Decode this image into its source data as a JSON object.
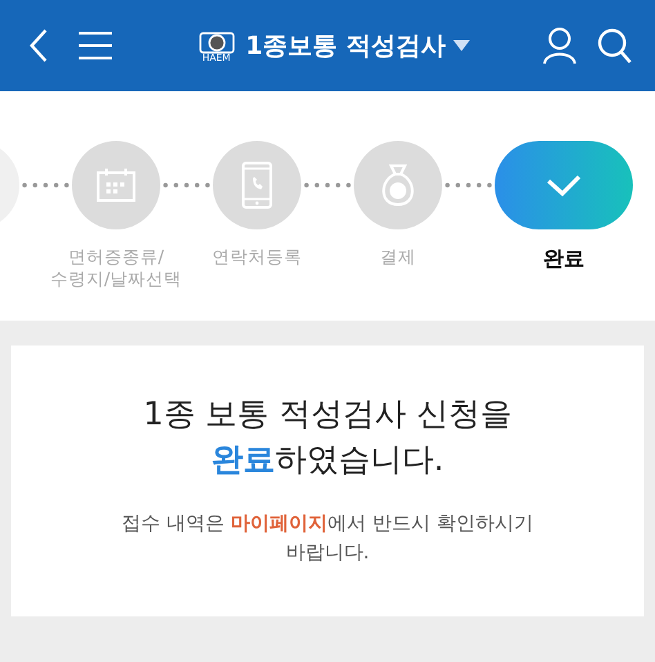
{
  "header": {
    "title": "1종보통 적성검사",
    "logo_text": "HAEM"
  },
  "steps": [
    {
      "kind": "cut"
    },
    {
      "kind": "calendar",
      "label": "면허증종류/\n수령지/날짜선택",
      "selected": false
    },
    {
      "kind": "phone",
      "label": "연락처등록",
      "selected": false
    },
    {
      "kind": "money",
      "label": "결제",
      "selected": false
    },
    {
      "kind": "check",
      "label": "완료",
      "selected": true
    }
  ],
  "message": {
    "headline": "1종 보통 적성검사 신청을\n**완료**하였습니다.",
    "note": "접수 내역은 **마이페이지**에서 반드시 확인하시기\n바랍니다."
  }
}
